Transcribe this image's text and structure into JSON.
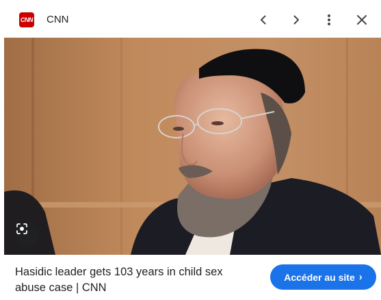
{
  "header": {
    "logo_text": "CNN",
    "source_name": "CNN",
    "icons": {
      "previous": "chevron-left-icon",
      "next": "chevron-right-icon",
      "more": "more-vert-icon",
      "close": "close-icon"
    }
  },
  "image": {
    "lens_icon": "lens-icon"
  },
  "footer": {
    "headline": "Hasidic leader gets 103 years in child sex abuse case | CNN",
    "visit_button_label": "Accéder au site",
    "visit_button_icon": "chevron-right-icon"
  },
  "colors": {
    "brand_red": "#cc0000",
    "accent_blue": "#1a73e8",
    "text": "#202124",
    "icon": "#5f6368"
  }
}
